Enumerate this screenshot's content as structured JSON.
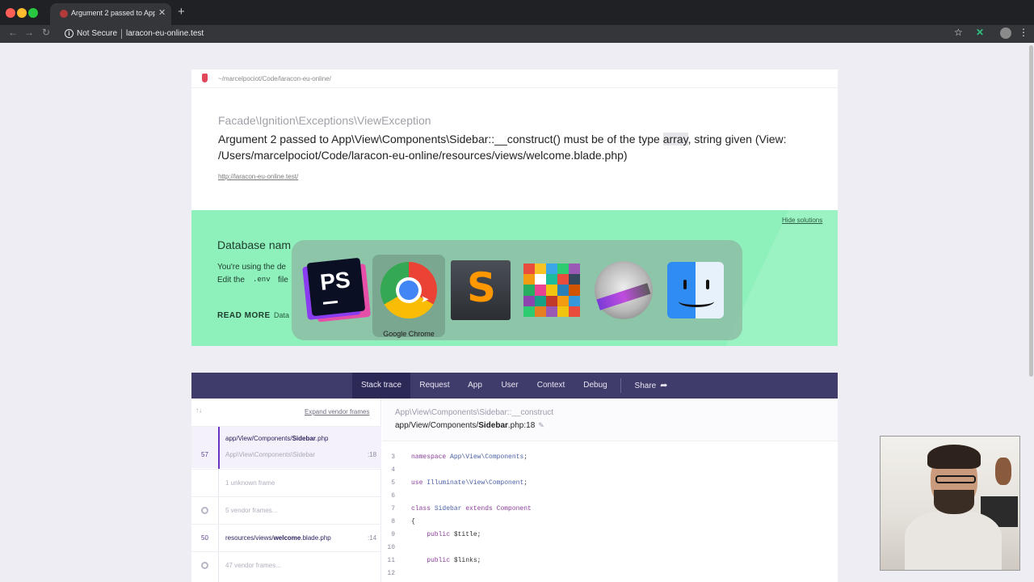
{
  "browser": {
    "tab_title": "Argument 2 passed to App",
    "tab_close": "✕",
    "new_tab": "+",
    "security_label": "Not Secure",
    "url": "laracon-eu-online.test",
    "info_glyph": "i"
  },
  "error": {
    "project_path": "~/marcelpociot/Code/laracon-eu-online/",
    "exception_class": "Facade\\Ignition\\Exceptions\\ViewException",
    "message_part1": "Argument 2 passed to App\\View\\Components\\Sidebar::__construct() must be of the type ",
    "message_highlight": "array",
    "message_part2": ", string given (View: /Users/marcelpociot/Code/laracon-eu-online/resources/views/welcome.blade.php)",
    "request_url": "http://laracon-eu-online.test/"
  },
  "solution": {
    "hide_label": "Hide solutions",
    "title": "Database nam",
    "line1": "You're using the de",
    "line2_pre": "Edit the",
    "line2_code": ".env",
    "line2_post": "file",
    "read_more": "READ MORE",
    "link": "Data"
  },
  "app_switcher": {
    "apps": [
      "PhpStorm",
      "Google Chrome",
      "Sublime Text",
      "Paint",
      "iMovie",
      "Finder"
    ],
    "selected_label": "Google Chrome",
    "ps_text": "PS",
    "sublime_text": "S",
    "paint_colors": [
      "#e94c3d",
      "#f7c325",
      "#3aa7e8",
      "#2ecc71",
      "#9b59b6",
      "#f39c12",
      "#ffffff",
      "#1abc9c",
      "#e74c3c",
      "#34495e",
      "#27ae60",
      "#e84393",
      "#f1c40f",
      "#2980b9",
      "#d35400",
      "#8e44ad",
      "#16a085",
      "#c0392b",
      "#f39c12",
      "#3498db",
      "#2ecc71",
      "#e67e22",
      "#9b59b6",
      "#f1c40f",
      "#e74c3c"
    ]
  },
  "debug_tabs": {
    "items": [
      "Stack trace",
      "Request",
      "App",
      "User",
      "Context",
      "Debug"
    ],
    "share": "Share",
    "share_icon": "➦"
  },
  "stack": {
    "arrows": "↑↓",
    "expand_vendor": "Expand vendor frames",
    "frames": [
      {
        "number": "57",
        "file_prefix": "app/View/Components/",
        "file_bold": "Sidebar",
        "file_suffix": ".php",
        "class": "App\\View\\Components\\Sidebar",
        "line": ":18"
      },
      {
        "muted": "1 unknown frame"
      },
      {
        "muted": "5 vendor frames..."
      },
      {
        "number": "50",
        "file_prefix": "resources/views/",
        "file_bold": "welcome",
        "file_suffix": ".blade.php",
        "line": ":14"
      },
      {
        "muted": "47 vendor frames..."
      }
    ],
    "code_class": "App\\View\\Components\\Sidebar::__construct",
    "code_file_prefix": "app/View/Components/",
    "code_file_bold": "Sidebar",
    "code_file_suffix": ".php:18",
    "edit_glyph": "✎",
    "code_lines": [
      {
        "n": "3",
        "kw": "namespace",
        "rest": " ",
        "ns": "App\\View\\Components",
        "tail": ";"
      },
      {
        "n": "4"
      },
      {
        "n": "5",
        "kw": "use",
        "rest": " ",
        "ns": "Illuminate\\View\\Component",
        "tail": ";"
      },
      {
        "n": "6"
      },
      {
        "n": "7",
        "kw": "class",
        "rest": " ",
        "ns": "Sidebar",
        "tail": " extends Component",
        "tail_kw": "extends"
      },
      {
        "n": "8",
        "text": "{"
      },
      {
        "n": "9",
        "indent": "    ",
        "kw": "public",
        "tail": " $title;"
      },
      {
        "n": "10"
      },
      {
        "n": "11",
        "indent": "    ",
        "kw": "public",
        "tail": " $links;"
      },
      {
        "n": "12"
      }
    ]
  }
}
